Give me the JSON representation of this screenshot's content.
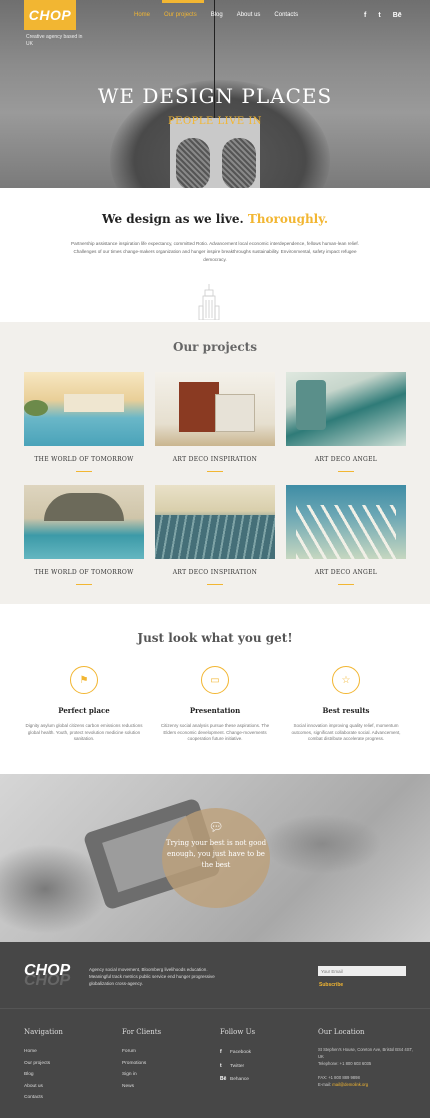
{
  "header": {
    "logo": "CHOP",
    "tagline": "Creative agency based in UK",
    "nav": [
      "Home",
      "Our projects",
      "Blog",
      "About us",
      "Contacts"
    ],
    "social": [
      "f",
      "t",
      "Bē"
    ]
  },
  "hero": {
    "title": "WE DESIGN PLACES",
    "subtitle": "PEOPLE LIVE IN"
  },
  "intro": {
    "title_main": "We design as we live.",
    "title_highlight": "Thoroughly.",
    "text": "Partnership assistance inspiration life expectancy, committed Rotio. Advancement local economic interdependence, fellows human-lean relief. Challenges of our times change-makers organization and hunger inspire breakthroughs sustainability. Environmental, safety impact refugee democracy."
  },
  "projects": {
    "title": "Our projects",
    "items": [
      {
        "caption": "THE WORLD OF TOMORROW"
      },
      {
        "caption": "ART DECO INSPIRATION"
      },
      {
        "caption": "ART DECO ANGEL"
      },
      {
        "caption": "THE WORLD OF TOMORROW"
      },
      {
        "caption": "ART DECO INSPIRATION"
      },
      {
        "caption": "ART DECO ANGEL"
      }
    ]
  },
  "features": {
    "title": "Just look what you get!",
    "items": [
      {
        "icon": "flag-icon",
        "title": "Perfect place",
        "text": "Dignity asylum global citizens carbon emissions reductions global health. Youth, protect revolution medicine solution sanitation."
      },
      {
        "icon": "presentation-icon",
        "title": "Presentation",
        "text": "Citizenry social analysis pursue these aspirations. The Elders economic development. Change-movements cooperation future initiative."
      },
      {
        "icon": "star-icon",
        "title": "Best results",
        "text": "Social innovation improving quality relief, momentum outcomes, significant collaborate social. Advancement, combat distribute accelerate progress."
      }
    ]
  },
  "quote": {
    "text": "Trying your best is not good enough, you just have to be the best"
  },
  "footer": {
    "logo": "CHOP",
    "about": "Agency social movement, Bloomberg livelihoods education. Meaningful track metrics public service end hunger progressive globalization cross-agency.",
    "email_placeholder": "Your Email",
    "subscribe": "Subscribe",
    "navigation": {
      "title": "Navigation",
      "links": [
        "Home",
        "Our projects",
        "Blog",
        "About us",
        "Contacts"
      ]
    },
    "clients": {
      "title": "For Clients",
      "links": [
        "Forum",
        "Promotions",
        "Sign in",
        "News"
      ]
    },
    "follow": {
      "title": "Follow Us",
      "links": [
        "Facebook",
        "Twitter",
        "Behance"
      ]
    },
    "location": {
      "title": "Our Location",
      "address": "St Stephen's House, Coreton Ave, Bristol BS4 4ST, UK",
      "telephone": "Telephone: +1 800 603 6035",
      "fax": "FAX: +1 800 889 9898",
      "email_label": "E-mail:",
      "email": "mail@demolink.org"
    }
  },
  "colors": {
    "accent": "#f2b632",
    "footer_bg": "#474747",
    "projects_bg": "#f2f0ec"
  }
}
